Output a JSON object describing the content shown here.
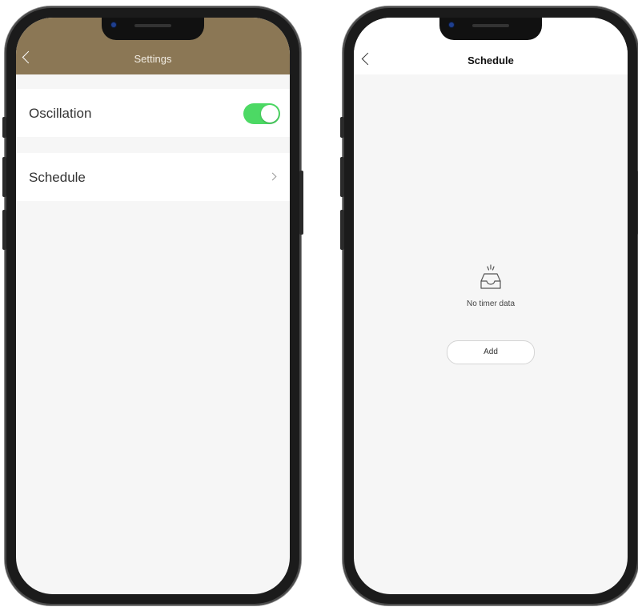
{
  "left_screen": {
    "header": {
      "title": "Settings",
      "color": "#8b7755"
    },
    "rows": [
      {
        "label": "Oscillation",
        "toggle_on": true
      },
      {
        "label": "Schedule",
        "has_chevron": true
      }
    ],
    "toggle_color": "#4cd964"
  },
  "right_screen": {
    "header": {
      "title": "Schedule"
    },
    "empty_state": {
      "icon": "empty-tray-icon",
      "message": "No timer data"
    },
    "add_button": "Add"
  }
}
